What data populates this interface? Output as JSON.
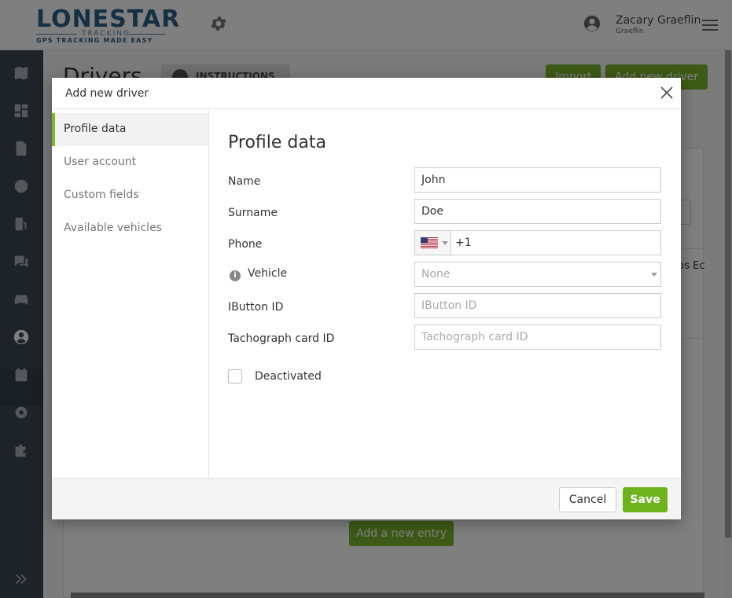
{
  "brand": {
    "name": "LONESTAR",
    "subtitle": "TRACKING",
    "tagline": "GPS TRACKING MADE EASY",
    "primary_color": "#2a5f86",
    "accent_color": "#7ab72f"
  },
  "header": {
    "user_name": "Zacary Graeflin",
    "user_sub": "Graeflin"
  },
  "sidebar": {
    "items": [
      {
        "icon": "map-icon"
      },
      {
        "icon": "dashboard-icon"
      },
      {
        "icon": "document-icon"
      },
      {
        "icon": "alert-icon"
      },
      {
        "icon": "fuel-icon"
      },
      {
        "icon": "chat-icon"
      },
      {
        "icon": "car-icon"
      },
      {
        "icon": "user-circle-icon",
        "active": true
      },
      {
        "icon": "calendar-icon"
      },
      {
        "icon": "settings-icon"
      },
      {
        "icon": "puzzle-icon"
      },
      {
        "icon": "expand-icon"
      }
    ]
  },
  "page": {
    "title": "Drivers",
    "instructions_label": "INSTRUCTIONS",
    "import_label": "Import",
    "add_driver_label": "Add new driver",
    "partial_text": "ps Ec",
    "add_entry_label": "Add a new entry"
  },
  "modal": {
    "title": "Add new driver",
    "nav": [
      {
        "label": "Profile data",
        "active": true
      },
      {
        "label": "User account"
      },
      {
        "label": "Custom fields"
      },
      {
        "label": "Available vehicles"
      }
    ],
    "section_title": "Profile data",
    "fields": {
      "name": {
        "label": "Name",
        "value": "John"
      },
      "surname": {
        "label": "Surname",
        "value": "Doe"
      },
      "phone": {
        "label": "Phone",
        "value": "+1",
        "country": "US"
      },
      "vehicle": {
        "label": "Vehicle",
        "value": "None"
      },
      "ibutton": {
        "label": "IButton ID",
        "placeholder": "IButton ID"
      },
      "tachograph": {
        "label": "Tachograph card ID",
        "placeholder": "Tachograph card ID"
      }
    },
    "deactivated_label": "Deactivated",
    "cancel_label": "Cancel",
    "save_label": "Save"
  }
}
